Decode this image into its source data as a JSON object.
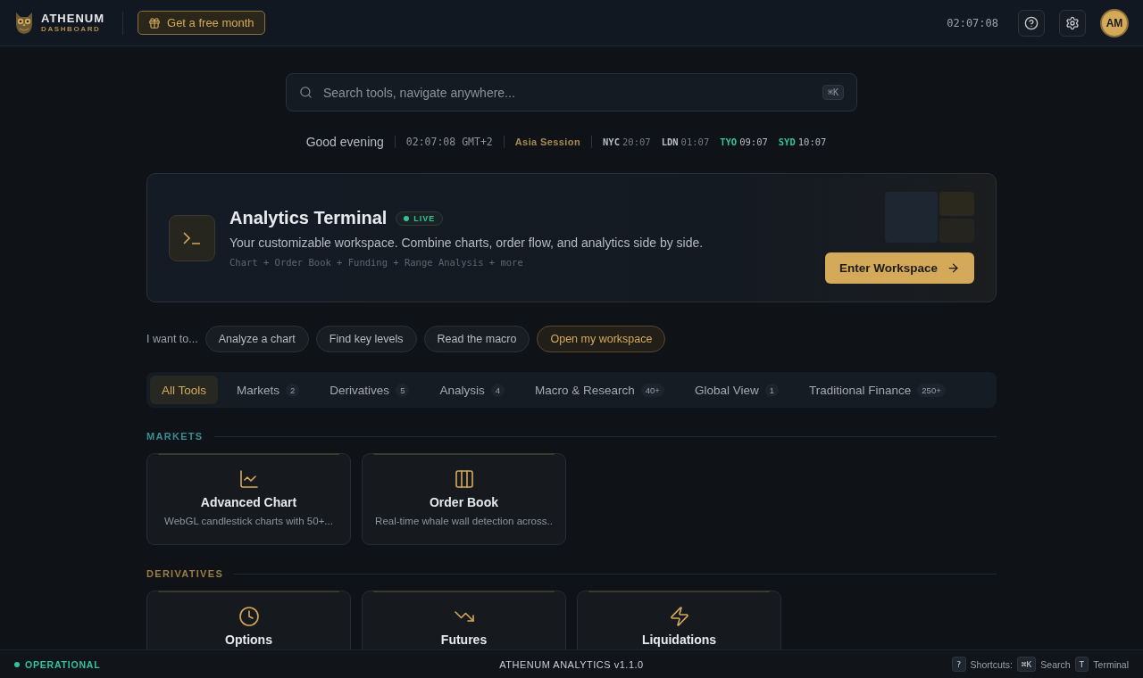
{
  "header": {
    "logo": {
      "title": "ATHENUM",
      "subtitle": "DASHBOARD"
    },
    "promo": "Get a free month",
    "clock": "02:07:08",
    "avatar": "AM"
  },
  "search": {
    "placeholder": "Search tools, navigate anywhere...",
    "shortcut": "⌘K"
  },
  "status_line": {
    "greeting": "Good evening",
    "time": "02:07:08 GMT+2",
    "session": "Asia Session",
    "markets": [
      {
        "code": "NYC",
        "time": "20:07",
        "open": false
      },
      {
        "code": "LDN",
        "time": "01:07",
        "open": false
      },
      {
        "code": "TYO",
        "time": "09:07",
        "open": true
      },
      {
        "code": "SYD",
        "time": "10:07",
        "open": true
      }
    ]
  },
  "banner": {
    "title": "Analytics Terminal",
    "badge": "LIVE",
    "description": "Your customizable workspace. Combine charts, order flow, and analytics side by side.",
    "modules": "Chart + Order Book + Funding + Range Analysis + more",
    "button": "Enter Workspace"
  },
  "intents": {
    "label": "I want to...",
    "chips": [
      {
        "label": "Analyze a chart",
        "highlighted": false
      },
      {
        "label": "Find key levels",
        "highlighted": false
      },
      {
        "label": "Read the macro",
        "highlighted": false
      },
      {
        "label": "Open my workspace",
        "highlighted": true
      }
    ]
  },
  "tabs": [
    {
      "label": "All Tools",
      "selected": true
    },
    {
      "label": "Markets",
      "count": "2",
      "selected": false
    },
    {
      "label": "Derivatives",
      "count": "5",
      "selected": false
    },
    {
      "label": "Analysis",
      "count": "4",
      "selected": false
    },
    {
      "label": "Macro & Research",
      "count": "40+",
      "selected": false
    },
    {
      "label": "Global View",
      "count": "1",
      "selected": false
    },
    {
      "label": "Traditional Finance",
      "count": "250+",
      "selected": false
    }
  ],
  "sections": [
    {
      "title": "MARKETS",
      "color": "#3a8f94",
      "tools": [
        {
          "kind": "chart",
          "name": "Advanced Chart",
          "description": "WebGL candlestick charts with 50+..."
        },
        {
          "kind": "book",
          "name": "Order Book",
          "description": "Real-time whale wall detection across.."
        }
      ]
    },
    {
      "title": "DERIVATIVES",
      "color": "#9a7d45",
      "tools": [
        {
          "kind": "options",
          "name": "Options"
        },
        {
          "kind": "futures",
          "name": "Futures"
        },
        {
          "kind": "liquidations",
          "name": "Liquidations"
        }
      ]
    }
  ],
  "footer": {
    "status": "OPERATIONAL",
    "version": "ATHENUM ANALYTICS v1.1.0",
    "help": "?",
    "shortcuts_label": "Shortcuts:",
    "shortcuts": [
      {
        "key": "⌘K",
        "label": "Search"
      },
      {
        "key": "T",
        "label": "Terminal"
      }
    ]
  }
}
